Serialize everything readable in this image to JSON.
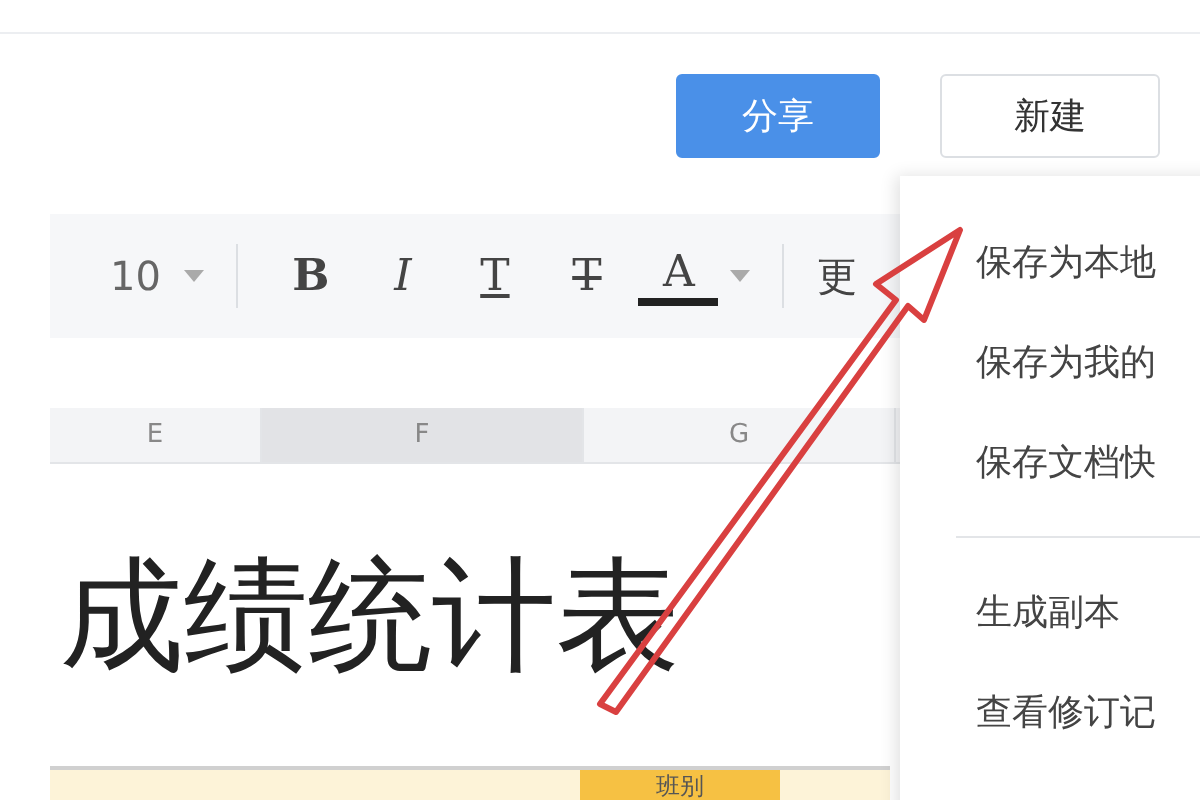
{
  "header": {
    "buttons": [
      {
        "label": "分享",
        "kind": "primary"
      },
      {
        "label": "新建",
        "kind": "default"
      }
    ]
  },
  "toolbar": {
    "font_size": "10",
    "tools": [
      {
        "label": "B",
        "kind": "bold"
      },
      {
        "label": "I",
        "kind": "italic"
      },
      {
        "label": "T",
        "kind": "underline"
      },
      {
        "label": "T",
        "kind": "strike"
      },
      {
        "label": "A",
        "kind": "color"
      }
    ],
    "more": "更"
  },
  "columns": [
    {
      "label": "E",
      "selected": false
    },
    {
      "label": "F",
      "selected": true
    },
    {
      "label": "G",
      "selected": false
    }
  ],
  "sheet": {
    "title": "成绩统计表",
    "header_cell": "班别"
  },
  "menu": {
    "items": [
      {
        "label": "保存为本地",
        "kind": "item"
      },
      {
        "label": "保存为我的",
        "kind": "item"
      },
      {
        "label": "保存文档快",
        "kind": "item"
      },
      {
        "kind": "divider"
      },
      {
        "label": "生成副本",
        "kind": "item"
      },
      {
        "label": "查看修订记",
        "kind": "item"
      }
    ]
  }
}
